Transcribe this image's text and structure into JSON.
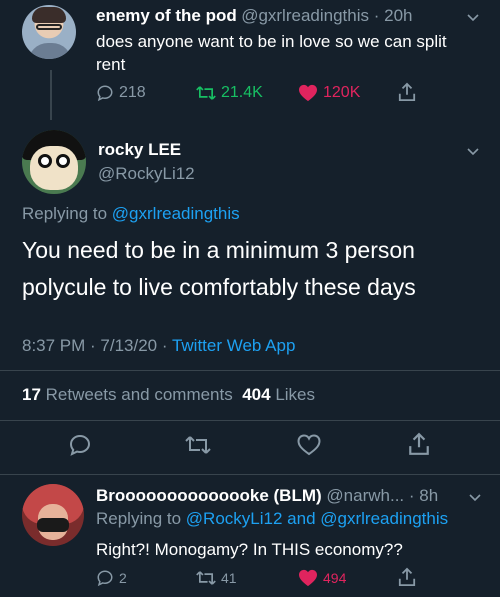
{
  "tweet1": {
    "name": "enemy of the pod",
    "handle": "@gxrlreadingthis",
    "time": "20h",
    "text": "does anyone want to be in love so we can split rent",
    "replies": "218",
    "retweets": "21.4K",
    "likes": "120K"
  },
  "main": {
    "name": "rocky LEE",
    "handle": "@RockyLi12",
    "replying_prefix": "Replying to",
    "replying_to": "@gxrlreadingthis",
    "text": "You need to be in a minimum 3 person polycule to live comfortably these days",
    "time": "8:37 PM · 7/13/20 ·",
    "source": "Twitter Web App",
    "retweets_count": "17",
    "retweets_label": "Retweets and comments",
    "likes_count": "404",
    "likes_label": "Likes"
  },
  "reply": {
    "name": "Broooooooooooooke (BLM)",
    "handle": "@narwh...",
    "time": "· 8h",
    "replying_prefix": "Replying to",
    "replying_to_1": "@RockyLi12",
    "and": "and",
    "replying_to_2": "@gxrlreadingthis",
    "text": "Right?! Monogamy? In THIS economy??",
    "replies": "2",
    "retweets": "41",
    "likes": "494"
  },
  "colors": {
    "background": "#15202b",
    "secondary_text": "#8899a6",
    "link": "#1da1f2",
    "retweet_green": "#17bf63",
    "like_pink": "#e0245e",
    "divider": "#38444d"
  },
  "icons": [
    "chevron-down-icon",
    "reply-icon",
    "retweet-icon",
    "heart-icon",
    "share-icon"
  ]
}
